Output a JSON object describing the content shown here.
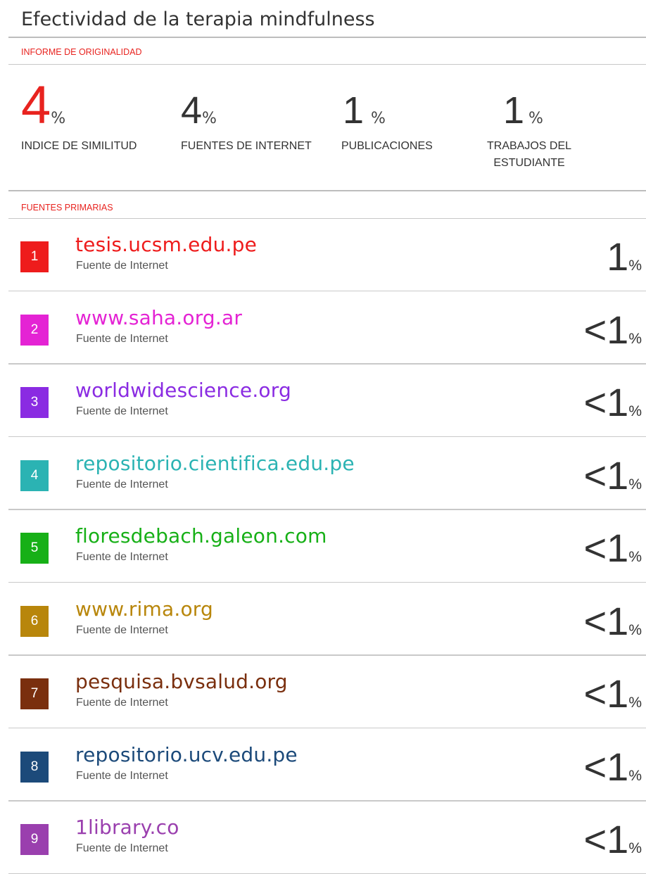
{
  "title": "Efectividad de la terapia mindfulness",
  "report_label": "INFORME DE ORIGINALIDAD",
  "stats": [
    {
      "value": "4",
      "unit": "%",
      "label": "INDICE DE SIMILITUD",
      "color": "#e8231f"
    },
    {
      "value": "4",
      "unit": "%",
      "label": "FUENTES DE INTERNET",
      "color": "#333333"
    },
    {
      "value": "1",
      "unit": "%",
      "label": "PUBLICACIONES",
      "color": "#333333"
    },
    {
      "value": "1",
      "unit": "%",
      "label_line1": "TRABAJOS DEL",
      "label_line2": "ESTUDIANTE",
      "color": "#333333"
    }
  ],
  "primary_sources_label": "FUENTES PRIMARIAS",
  "sources": [
    {
      "num": "1",
      "name": "tesis.ucsm.edu.pe",
      "type": "Fuente de Internet",
      "value": "1",
      "unit": "%",
      "color": "#ee1c1c"
    },
    {
      "num": "2",
      "name": "www.saha.org.ar",
      "type": "Fuente de Internet",
      "value": "<1",
      "unit": "%",
      "color": "#e423d4"
    },
    {
      "num": "3",
      "name": "worldwidescience.org",
      "type": "Fuente de Internet",
      "value": "<1",
      "unit": "%",
      "color": "#8a2be2"
    },
    {
      "num": "4",
      "name": "repositorio.cientifica.edu.pe",
      "type": "Fuente de Internet",
      "value": "<1",
      "unit": "%",
      "color": "#2bb3b3"
    },
    {
      "num": "5",
      "name": "floresdebach.galeon.com",
      "type": "Fuente de Internet",
      "value": "<1",
      "unit": "%",
      "color": "#17b017"
    },
    {
      "num": "6",
      "name": "www.rima.org",
      "type": "Fuente de Internet",
      "value": "<1",
      "unit": "%",
      "color": "#b8860b"
    },
    {
      "num": "7",
      "name": "pesquisa.bvsalud.org",
      "type": "Fuente de Internet",
      "value": "<1",
      "unit": "%",
      "color": "#7a2f0e"
    },
    {
      "num": "8",
      "name": "repositorio.ucv.edu.pe",
      "type": "Fuente de Internet",
      "value": "<1",
      "unit": "%",
      "color": "#1c4a7a"
    },
    {
      "num": "9",
      "name": "1library.co",
      "type": "Fuente de Internet",
      "value": "<1",
      "unit": "%",
      "color": "#9a3fae"
    }
  ]
}
